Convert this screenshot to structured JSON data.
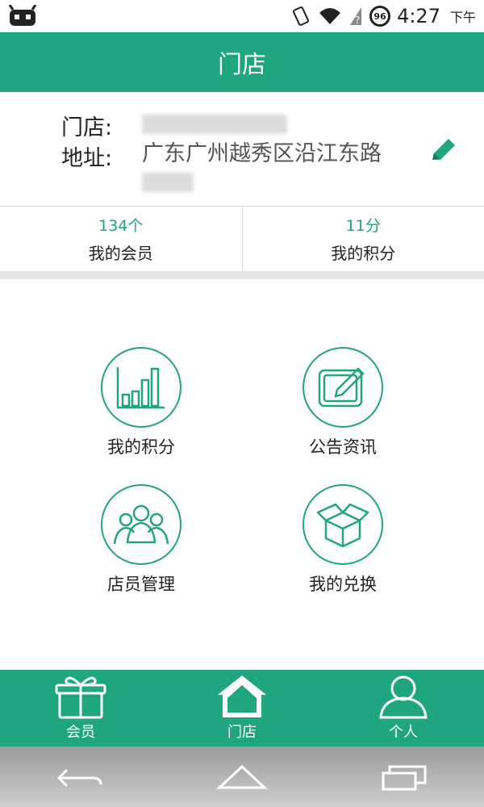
{
  "status_bar": {
    "time": "4:27",
    "ampm": "下午",
    "battery": "96"
  },
  "header": {
    "title": "门店"
  },
  "store": {
    "name_label": "门店:",
    "address_label": "地址:",
    "address_value": "广东广州越秀区沿江东路"
  },
  "stats": [
    {
      "value": "134个",
      "label": "我的会员"
    },
    {
      "value": "11分",
      "label": "我的积分"
    }
  ],
  "tiles": [
    {
      "label": "我的积分",
      "icon": "bar-chart-icon"
    },
    {
      "label": "公告资讯",
      "icon": "note-edit-icon"
    },
    {
      "label": "店员管理",
      "icon": "staff-group-icon"
    },
    {
      "label": "我的兑换",
      "icon": "open-box-icon"
    }
  ],
  "bottom_nav": [
    {
      "label": "会员",
      "icon": "gift-icon"
    },
    {
      "label": "门店",
      "icon": "house-icon"
    },
    {
      "label": "个人",
      "icon": "person-icon"
    }
  ],
  "colors": {
    "accent": "#1fa57f"
  }
}
